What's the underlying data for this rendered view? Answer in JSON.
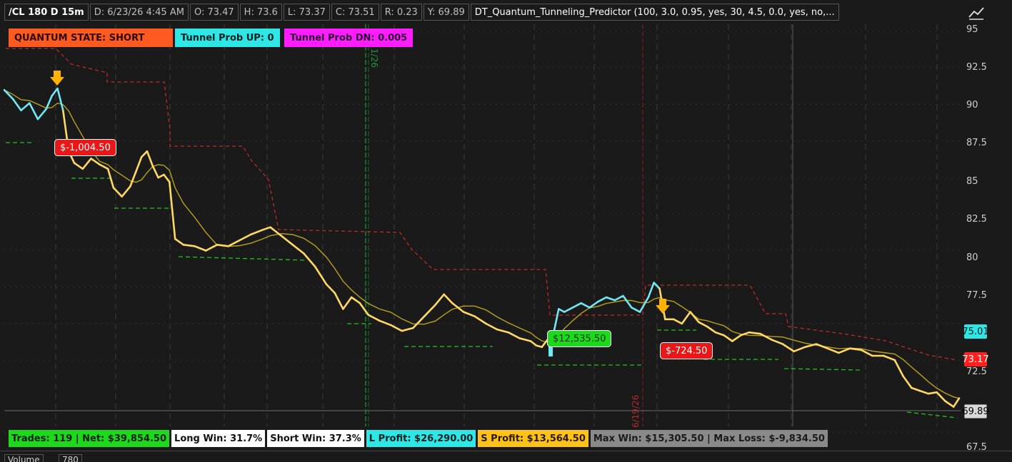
{
  "header": {
    "symbol": "/CL 180 D 15m",
    "date": "D: 6/23/26 4:45 AM",
    "open": "O: 73.47",
    "high": "H: 73.6",
    "low": "L: 73.37",
    "close": "C: 73.51",
    "range": "R: 0.23",
    "y": "Y: 69.89",
    "study": "DT_Quantum_Tunneling_Predictor (100, 3.0, 0.95, yes, 30, 4.5, 0.0, yes, no,..."
  },
  "labels": {
    "quantum_state": "QUANTUM STATE: SHORT",
    "tunnel_up": "Tunnel Prob UP: 0",
    "tunnel_dn": "Tunnel Prob DN: 0.005"
  },
  "price_axis": {
    "ticks": [
      "95",
      "92.5",
      "90",
      "87.5",
      "85",
      "82.5",
      "80",
      "77.5",
      "75",
      "72.5",
      "67.5"
    ],
    "tags": {
      "cyan": "75.01",
      "red": "73.17",
      "last": "69.89"
    }
  },
  "vertical_labels": {
    "first": "1/26",
    "second": "6/19/26"
  },
  "trades": {
    "first_loss": "$-1,004.50",
    "long_win": "$12,535.50",
    "second_loss": "$-724.50"
  },
  "stats": {
    "trades": "Trades: 119 | Net: $39,854.50",
    "long_win": "Long Win: 31.7%",
    "short_win": "Short Win: 37.3%",
    "l_profit": "L Profit: $26,290.00",
    "s_profit": "S Profit: $13,564.50",
    "max": "Max Win: $15,305.50 | Max Loss: $-9,834.50"
  },
  "volume": {
    "label": "Volume",
    "value": "780"
  },
  "colors": {
    "bg": "#1a1a1a",
    "price_yellow": "#ffd966",
    "price_cyan": "#6ee9f5",
    "ma_olive": "#b8a21a",
    "stop_red": "#c0292b",
    "support_green": "#22c322",
    "state_orange": "#ff5a1f",
    "cyan_label": "#2ee6e6",
    "magenta_label": "#ff1cff"
  },
  "chart_data": {
    "type": "line",
    "title": "",
    "xlabel": "",
    "ylabel": "",
    "ylim": [
      66.5,
      95.5
    ],
    "grid": true,
    "series": [
      {
        "name": "",
        "points": [
          [
            0,
            91.0
          ],
          [
            3,
            90.4
          ],
          [
            6,
            89.6
          ],
          [
            9,
            90.1
          ],
          [
            12,
            89.0
          ],
          [
            15,
            89.7
          ],
          [
            17,
            90.6
          ],
          [
            19,
            91.1
          ],
          [
            21,
            89.6
          ],
          [
            23,
            86.8
          ],
          [
            25,
            86.0
          ],
          [
            28,
            85.6
          ],
          [
            31,
            86.3
          ],
          [
            34,
            85.9
          ],
          [
            37,
            85.6
          ],
          [
            39,
            84.3
          ],
          [
            42,
            83.7
          ],
          [
            45,
            84.4
          ],
          [
            47,
            85.4
          ],
          [
            49,
            86.4
          ],
          [
            51,
            86.8
          ],
          [
            53,
            85.8
          ],
          [
            55,
            85.0
          ],
          [
            57,
            85.2
          ],
          [
            59,
            84.7
          ],
          [
            61,
            80.8
          ],
          [
            64,
            80.4
          ],
          [
            68,
            80.3
          ],
          [
            72,
            80.0
          ],
          [
            76,
            80.4
          ],
          [
            80,
            80.3
          ],
          [
            84,
            80.7
          ],
          [
            88,
            81.1
          ],
          [
            92,
            81.4
          ],
          [
            95,
            81.6
          ],
          [
            99,
            81.0
          ],
          [
            103,
            80.4
          ],
          [
            107,
            79.8
          ],
          [
            111,
            78.9
          ],
          [
            115,
            77.7
          ],
          [
            118,
            77.1
          ],
          [
            121,
            76.0
          ],
          [
            124,
            76.8
          ],
          [
            127,
            76.4
          ],
          [
            130,
            75.6
          ],
          [
            134,
            75.2
          ],
          [
            138,
            74.9
          ],
          [
            142,
            74.5
          ],
          [
            146,
            74.7
          ],
          [
            150,
            75.5
          ],
          [
            154,
            76.3
          ],
          [
            157,
            77.0
          ],
          [
            160,
            76.4
          ],
          [
            164,
            75.8
          ],
          [
            168,
            75.5
          ],
          [
            172,
            75.0
          ],
          [
            176,
            74.6
          ],
          [
            180,
            74.4
          ],
          [
            184,
            74.0
          ],
          [
            188,
            73.8
          ],
          [
            190,
            73.5
          ],
          [
            192,
            73.4
          ],
          [
            194,
            73.9
          ],
          [
            196,
            74.2
          ],
          [
            198,
            76.0
          ],
          [
            200,
            75.8
          ],
          [
            203,
            76.1
          ],
          [
            206,
            76.4
          ],
          [
            209,
            76.1
          ],
          [
            212,
            76.5
          ],
          [
            215,
            76.8
          ],
          [
            218,
            76.6
          ],
          [
            221,
            76.9
          ],
          [
            224,
            76.1
          ],
          [
            227,
            75.8
          ],
          [
            230,
            76.8
          ],
          [
            232,
            77.8
          ],
          [
            234,
            77.4
          ],
          [
            236,
            75.3
          ],
          [
            239,
            75.3
          ],
          [
            242,
            75.0
          ],
          [
            245,
            75.8
          ],
          [
            248,
            75.1
          ],
          [
            251,
            74.8
          ],
          [
            254,
            74.4
          ],
          [
            257,
            74.2
          ],
          [
            260,
            73.8
          ],
          [
            263,
            74.2
          ],
          [
            266,
            74.4
          ],
          [
            270,
            74.3
          ],
          [
            274,
            73.9
          ],
          [
            278,
            73.6
          ],
          [
            282,
            73.1
          ],
          [
            286,
            73.4
          ],
          [
            290,
            73.6
          ],
          [
            294,
            73.3
          ],
          [
            298,
            73.0
          ],
          [
            302,
            73.3
          ],
          [
            306,
            73.2
          ],
          [
            310,
            72.8
          ],
          [
            314,
            72.8
          ],
          [
            318,
            72.5
          ],
          [
            321,
            71.4
          ],
          [
            324,
            70.6
          ],
          [
            327,
            70.4
          ],
          [
            330,
            70.2
          ],
          [
            333,
            70.3
          ],
          [
            336,
            69.7
          ],
          [
            339,
            69.3
          ],
          [
            341,
            69.89
          ]
        ]
      }
    ]
  }
}
